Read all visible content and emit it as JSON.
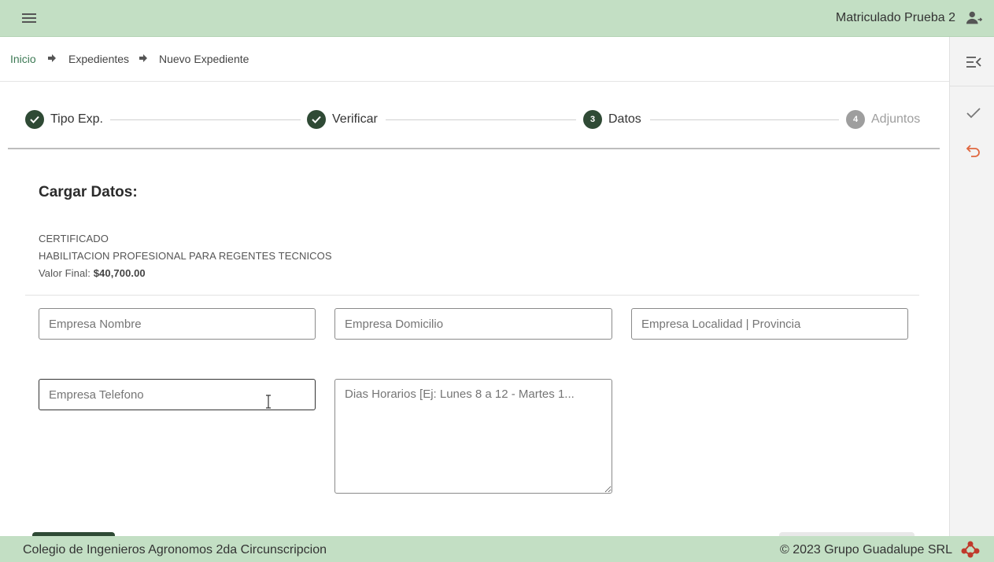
{
  "header": {
    "user_name": "Matriculado Prueba 2"
  },
  "breadcrumb": [
    "Inicio",
    "Expedientes",
    "Nuevo Expediente"
  ],
  "stepper": {
    "steps": [
      {
        "number": "",
        "label": "Tipo Exp.",
        "state": "done"
      },
      {
        "number": "",
        "label": "Verificar",
        "state": "done"
      },
      {
        "number": "3",
        "label": "Datos",
        "state": "active"
      },
      {
        "number": "4",
        "label": "Adjuntos",
        "state": "pending"
      }
    ]
  },
  "form": {
    "title": "Cargar Datos:",
    "type": "CERTIFICADO",
    "description": "HABILITACION PROFESIONAL PARA REGENTES TECNICOS",
    "valor_label": "Valor Final:",
    "valor_amount": "$40,700.00",
    "fields": {
      "empresa_nombre": "Empresa Nombre",
      "empresa_domicilio": "Empresa Domicilio",
      "empresa_localidad": "Empresa Localidad | Provincia",
      "empresa_telefono": "Empresa Telefono",
      "dias_horarios": "Dias Horarios [Ej: Lunes 8 a 12 - Martes 1..."
    }
  },
  "footer": {
    "left": "Colegio de Ingenieros Agronomos 2da Circunscripcion",
    "right": "© 2023 Grupo Guadalupe SRL"
  },
  "colors": {
    "bar": "#c3dfc4",
    "accent": "#2f4a35",
    "link": "#3d7a55",
    "undo": "#e0673f"
  },
  "icons": [
    "menu-icon",
    "user-switch-icon",
    "arrow-right-icon",
    "collapse-panel-icon",
    "check-icon",
    "undo-icon",
    "company-logo-icon"
  ]
}
